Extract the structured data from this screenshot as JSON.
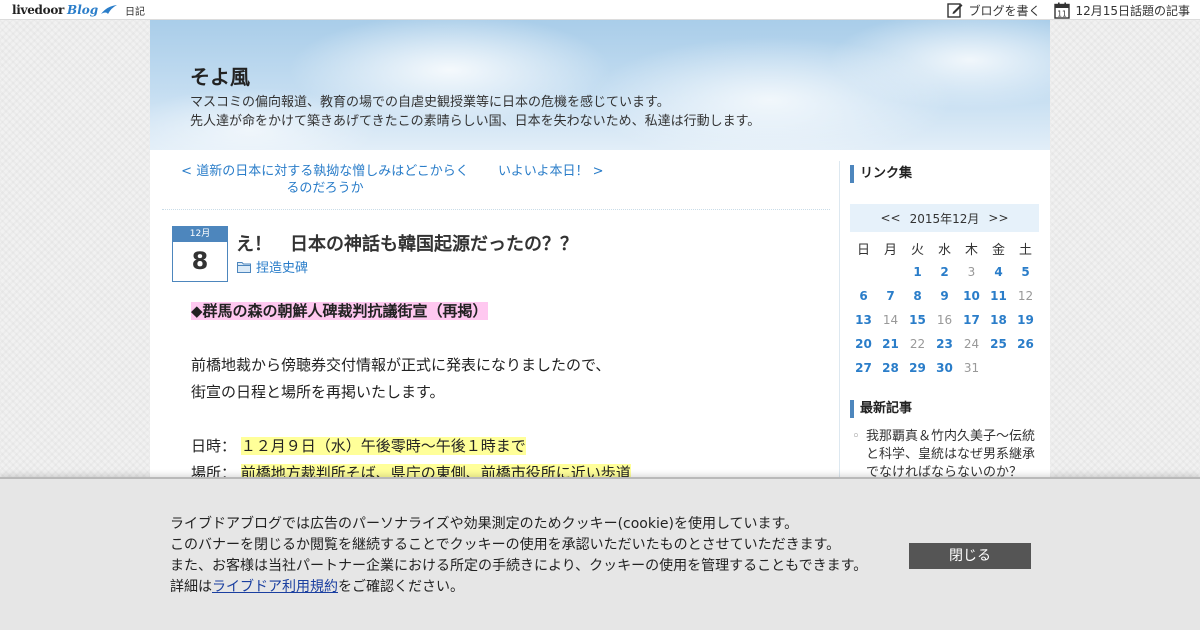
{
  "topbar": {
    "logo_word": "livedoor",
    "logo_blog": "Blog",
    "diary_link": "日記",
    "write_blog": "ブログを書く",
    "calendar_icon_day": "11",
    "topic_articles": "12月15日話題の記事"
  },
  "blog": {
    "title": "そよ風",
    "desc_line1": "マスコミの偏向報道、教育の場での自虐史観授業等に日本の危機を感じています。",
    "desc_line2": "先人達が命をかけて築きあげてきたこの素晴らしい国、日本を失わないため、私達は行動します。"
  },
  "pager": {
    "prev_line1": "< 道新の日本に対する執拗な憎しみはどこからく",
    "prev_line2": "るのだろうか",
    "next": "いよいよ本日！ >"
  },
  "post": {
    "date_month": "12月",
    "date_day": "8",
    "title": "え！　日本の神話も韓国起源だったの？？",
    "category": "捏造史碑",
    "heading": "◆群馬の森の朝鮮人碑裁判抗議街宣（再掲）",
    "para1_line1": "前橋地裁から傍聴券交付情報が正式に発表になりましたので、",
    "para1_line2": "街宣の日程と場所を再掲いたします。",
    "datetime_label": "日時：",
    "datetime_value": "１２月９日（水）午後零時～午後１時まで",
    "place_label": "場所：",
    "place_value": "前橋地方裁判所そば、県庁の東側、前橋市役所に近い歩道"
  },
  "sidebar": {
    "links_heading": "リンク集",
    "calendar": {
      "prev": "<<",
      "month": "2015年12月",
      "next": ">>",
      "weekdays": [
        "日",
        "月",
        "火",
        "水",
        "木",
        "金",
        "土"
      ],
      "weeks": [
        [
          "",
          "",
          "1",
          "2",
          "3",
          "4",
          "5"
        ],
        [
          "6",
          "7",
          "8",
          "9",
          "10",
          "11",
          "12"
        ],
        [
          "13",
          "14",
          "15",
          "16",
          "17",
          "18",
          "19"
        ],
        [
          "20",
          "21",
          "22",
          "23",
          "24",
          "25",
          "26"
        ],
        [
          "27",
          "28",
          "29",
          "30",
          "31",
          "",
          ""
        ]
      ],
      "days_without_posts": [
        "3",
        "12",
        "14",
        "16",
        "22",
        "24",
        "31"
      ]
    },
    "recent_heading": "最新記事",
    "recent_items": [
      "我那覇真＆竹内久美子～伝統と科学、皇統はなぜ男系継承でなければならないのか？"
    ]
  },
  "cookie": {
    "line1": "ライブドアブログでは広告のパーソナライズや効果測定のためクッキー(cookie)を使用しています。",
    "line2": "このバナーを閉じるか閲覧を継続することでクッキーの使用を承認いただいたものとさせていただきます。",
    "line3": "また、お客様は当社パートナー企業における所定の手続きにより、クッキーの使用を管理することもできます。",
    "line4_pre": "詳細は",
    "line4_link": "ライブドア利用規約",
    "line4_post": "をご確認ください。",
    "close_button": "閉じる"
  },
  "colors": {
    "accent": "#4d86bd",
    "link": "#2a7dc9",
    "highlight_pink": "#ffc8f0",
    "highlight_yellow": "#ffff99",
    "close_button_bg": "#555555"
  }
}
